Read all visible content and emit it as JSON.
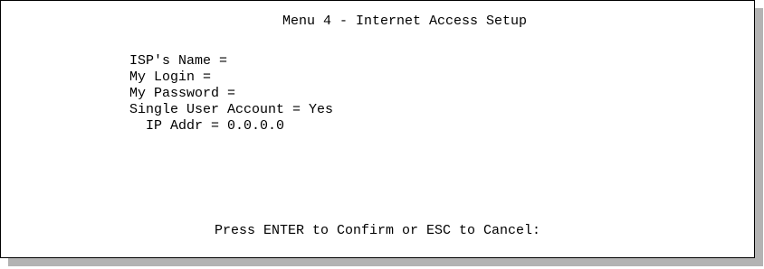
{
  "title": "Menu 4 - Internet Access Setup",
  "fields": [
    {
      "text": "ISP's Name ="
    },
    {
      "text": "My Login ="
    },
    {
      "text": "My Password ="
    },
    {
      "text": "Single User Account = Yes"
    },
    {
      "text": "IP Addr = 0.0.0.0"
    }
  ],
  "prompt": "Press ENTER to Confirm or ESC to Cancel:"
}
